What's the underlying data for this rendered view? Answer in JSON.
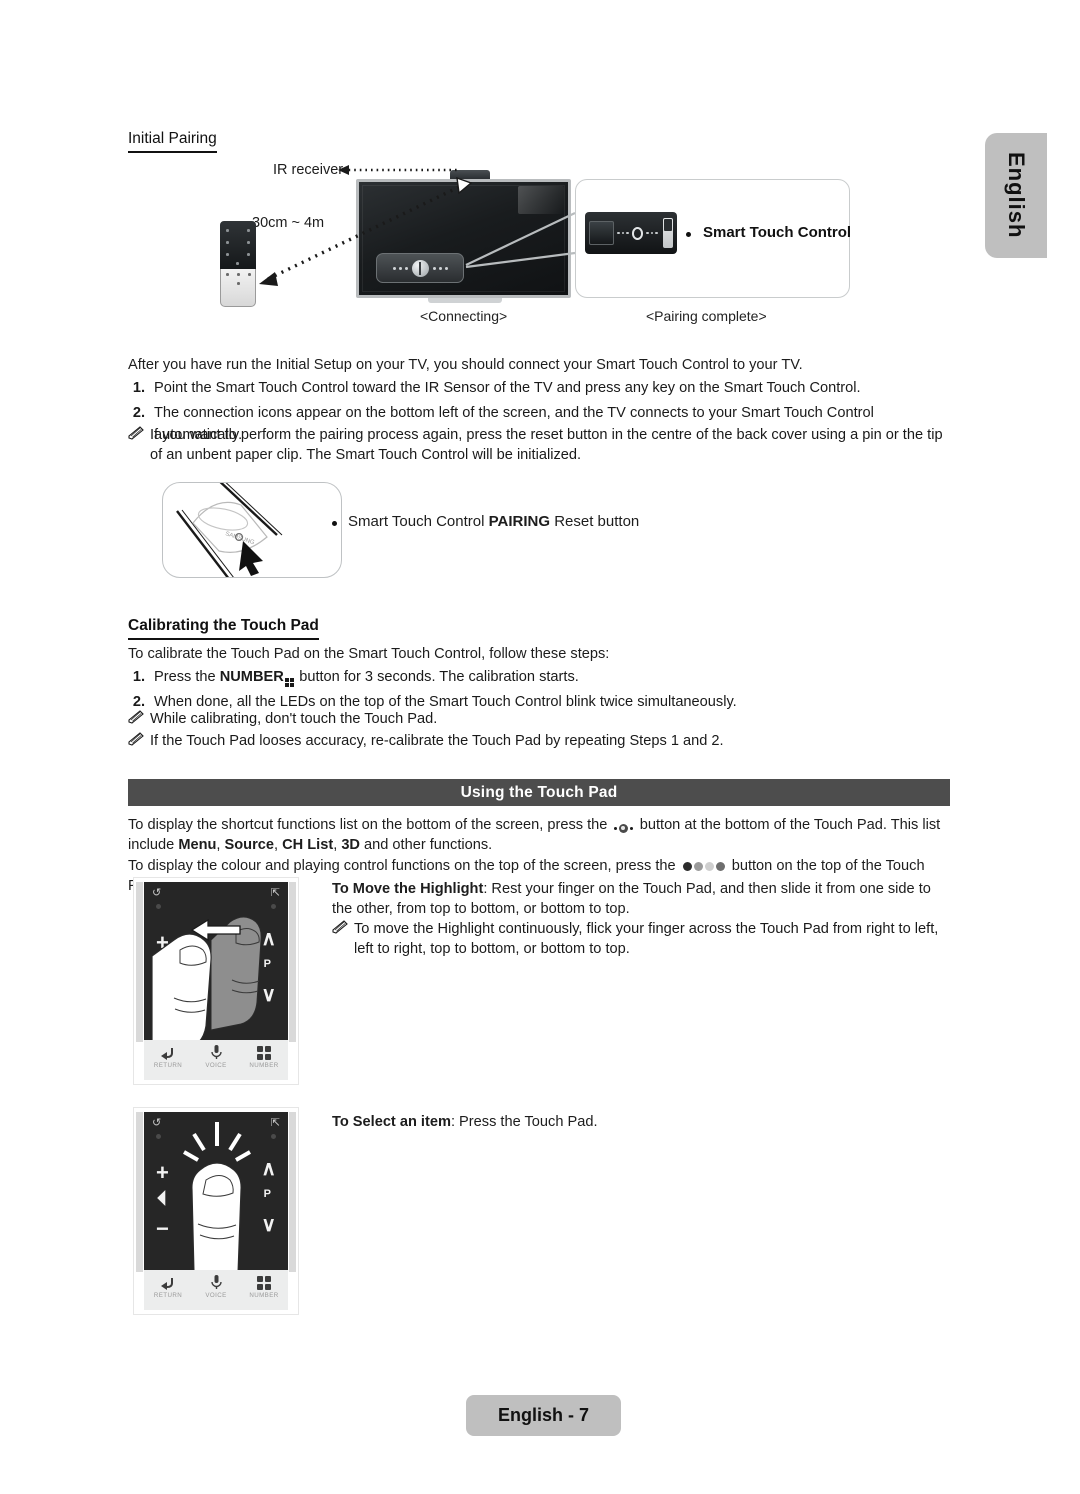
{
  "language_tab": {
    "label": "English"
  },
  "sections": {
    "initial_pairing": {
      "heading": "Initial Pairing",
      "figure": {
        "ir_receiver_label": "IR receiver",
        "distance_label": "30cm ~ 4m",
        "caption_left": "<Connecting>",
        "caption_right": "<Pairing complete>",
        "callout_label": "Smart Touch Control"
      },
      "intro": "After you have run the Initial Setup on your TV, you should connect your Smart Touch Control to your TV.",
      "steps": [
        {
          "num": "1.",
          "text": "Point the Smart Touch Control toward the IR Sensor of the TV and press any key on the Smart Touch Control."
        },
        {
          "num": "2.",
          "text": "The connection icons appear on the bottom left of the screen, and the TV connects to your Smart Touch Control automatically."
        }
      ],
      "note": "If you want to perform the pairing process again, press the reset button in the centre of the back cover using a pin or the tip of an unbent paper clip. The Smart Touch Control will be initialized.",
      "reset_label_prefix": "Smart Touch Control ",
      "reset_label_bold": "PAIRING",
      "reset_label_suffix": " Reset button"
    },
    "calibrating": {
      "heading": "Calibrating the Touch Pad",
      "intro": "To calibrate the Touch Pad on the Smart Touch Control, follow these steps:",
      "step1_prefix": "Press the ",
      "step1_bold": "NUMBER",
      "step1_suffix": " button for 3 seconds. The calibration starts.",
      "step1_num": "1.",
      "step2_num": "2.",
      "step2": "When done, all the LEDs on the top of the Smart Touch Control blink twice simultaneously.",
      "notes": [
        "While calibrating, don't touch the Touch Pad.",
        "If the Touch Pad looses accuracy, re-calibrate the Touch Pad by repeating Steps 1 and 2."
      ]
    },
    "using_touch_pad": {
      "banner_title": "Using the Touch Pad",
      "p1_a": "To display the shortcut functions list on the bottom of the screen, press the ",
      "p1_b": " button at the bottom of the Touch Pad. This list include ",
      "p1_bold1": "Menu",
      "p1_c": ", ",
      "p1_bold2": "Source",
      "p1_d": ", ",
      "p1_bold3": "CH List",
      "p1_e": ", ",
      "p1_bold4": "3D",
      "p1_f": " and other functions.",
      "p2_a": "To display the colour and playing control functions on the top of the screen, press the ",
      "p2_b": " button on the top of the Touch Pad.",
      "move_highlight_bold": "To Move the Highlight",
      "move_highlight_text": ": Rest your finger on the Touch Pad, and then slide it from one side to the other, from top to bottom, or bottom to top.",
      "move_highlight_note": "To move the Highlight continuously, flick your finger across the Touch Pad from right to left, left to right, top to bottom, or bottom to top.",
      "select_item_bold": "To Select an item",
      "select_item_text": ": Press the Touch Pad."
    }
  },
  "touchpad_figure": {
    "volume_up": "+",
    "volume_down": "−",
    "channel_up": "∧",
    "channel_down": "∨",
    "channel_label": "P",
    "buttons": [
      {
        "icon": "return-icon",
        "label": "RETURN"
      },
      {
        "icon": "voice-icon",
        "label": "VOICE"
      },
      {
        "icon": "number-icon",
        "label": "NUMBER"
      }
    ]
  },
  "footer": {
    "page_label": "English - 7"
  },
  "colors": {
    "banner_bg": "#4d4d4d",
    "tab_bg": "#bfbfbf",
    "text": "#1a1a1a",
    "pad_dark": "#262626"
  }
}
